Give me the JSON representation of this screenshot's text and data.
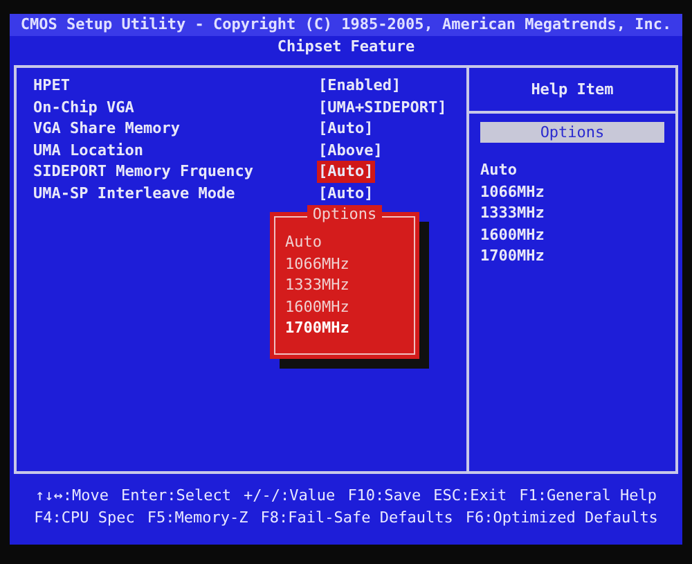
{
  "header": {
    "title": "CMOS Setup Utility - Copyright (C) 1985-2005, American Megatrends, Inc.",
    "subtitle": "Chipset Feature"
  },
  "settings": [
    {
      "label": "HPET",
      "value": "[Enabled]",
      "selected": false
    },
    {
      "label": "On-Chip VGA",
      "value": "[UMA+SIDEPORT]",
      "selected": false
    },
    {
      "label": "VGA Share Memory",
      "value": "[Auto]",
      "selected": false
    },
    {
      "label": "UMA Location",
      "value": "[Above]",
      "selected": false
    },
    {
      "label": "SIDEPORT Memory Frquency",
      "value": "[Auto]",
      "selected": true
    },
    {
      "label": "UMA-SP Interleave Mode",
      "value": "[Auto]",
      "selected": false
    }
  ],
  "help": {
    "title": "Help Item",
    "section": "Options",
    "lines": [
      "Auto",
      "1066MHz",
      "1333MHz",
      "1600MHz",
      "1700MHz"
    ]
  },
  "popup": {
    "title": "Options",
    "options": [
      {
        "label": "Auto",
        "selected": false
      },
      {
        "label": "1066MHz",
        "selected": false
      },
      {
        "label": "1333MHz",
        "selected": false
      },
      {
        "label": "1600MHz",
        "selected": false
      },
      {
        "label": "1700MHz",
        "selected": true
      }
    ]
  },
  "footer": {
    "lines": [
      [
        "↑↓↔:Move",
        "Enter:Select",
        "+/-/:Value",
        "F10:Save",
        "ESC:Exit",
        "F1:General Help"
      ],
      [
        "F4:CPU Spec",
        "F5:Memory-Z",
        "F8:Fail-Safe Defaults",
        "F6:Optimized Defaults"
      ]
    ]
  }
}
